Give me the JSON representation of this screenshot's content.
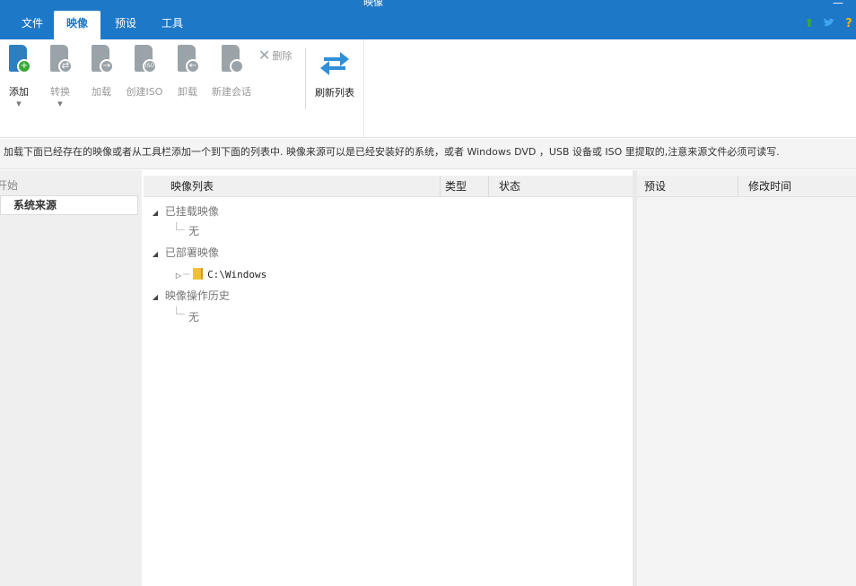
{
  "window": {
    "title": "映像",
    "minimize_label": "—"
  },
  "tabs": [
    {
      "label": "文件",
      "active": false
    },
    {
      "label": "映像",
      "active": true
    },
    {
      "label": "预设",
      "active": false
    },
    {
      "label": "工具",
      "active": false
    }
  ],
  "top_right_icons": [
    {
      "name": "arrow-up-icon",
      "glyph": "⬆",
      "color": "#3aaa35"
    },
    {
      "name": "twitter-icon",
      "glyph": "🐦",
      "color": "#40a6f0"
    },
    {
      "name": "help-icon",
      "glyph": "?",
      "color": "#f5b400"
    }
  ],
  "ribbon": {
    "add_label": "添加",
    "convert_label": "转换",
    "mount_label": "加载",
    "create_iso_label": "创建ISO",
    "unmount_label": "卸载",
    "new_session_label": "新建会话",
    "delete_label": "删除",
    "refresh_label": "刷新列表"
  },
  "info_text": "加载下面已经存在的映像或者从工具栏添加一个到下面的列表中. 映像来源可以是已经安装好的系统，或者 Windows DVD ，USB 设备或 ISO 里提取的,注意来源文件必须可读写.",
  "sidebar": {
    "heading": "开始",
    "item": "系统来源"
  },
  "list": {
    "columns": [
      "映像列表",
      "类型",
      "状态"
    ],
    "groups": [
      {
        "label": "已挂载映像",
        "child": "无"
      },
      {
        "label": "已部署映像",
        "child": "C:\\Windows"
      },
      {
        "label": "映像操作历史",
        "child": "无"
      }
    ]
  },
  "details": {
    "columns": [
      "预设",
      "修改时间"
    ]
  },
  "colors": {
    "accent": "#1e78c8",
    "add_badge": "#3aaa35",
    "folder": "#f2c038"
  }
}
